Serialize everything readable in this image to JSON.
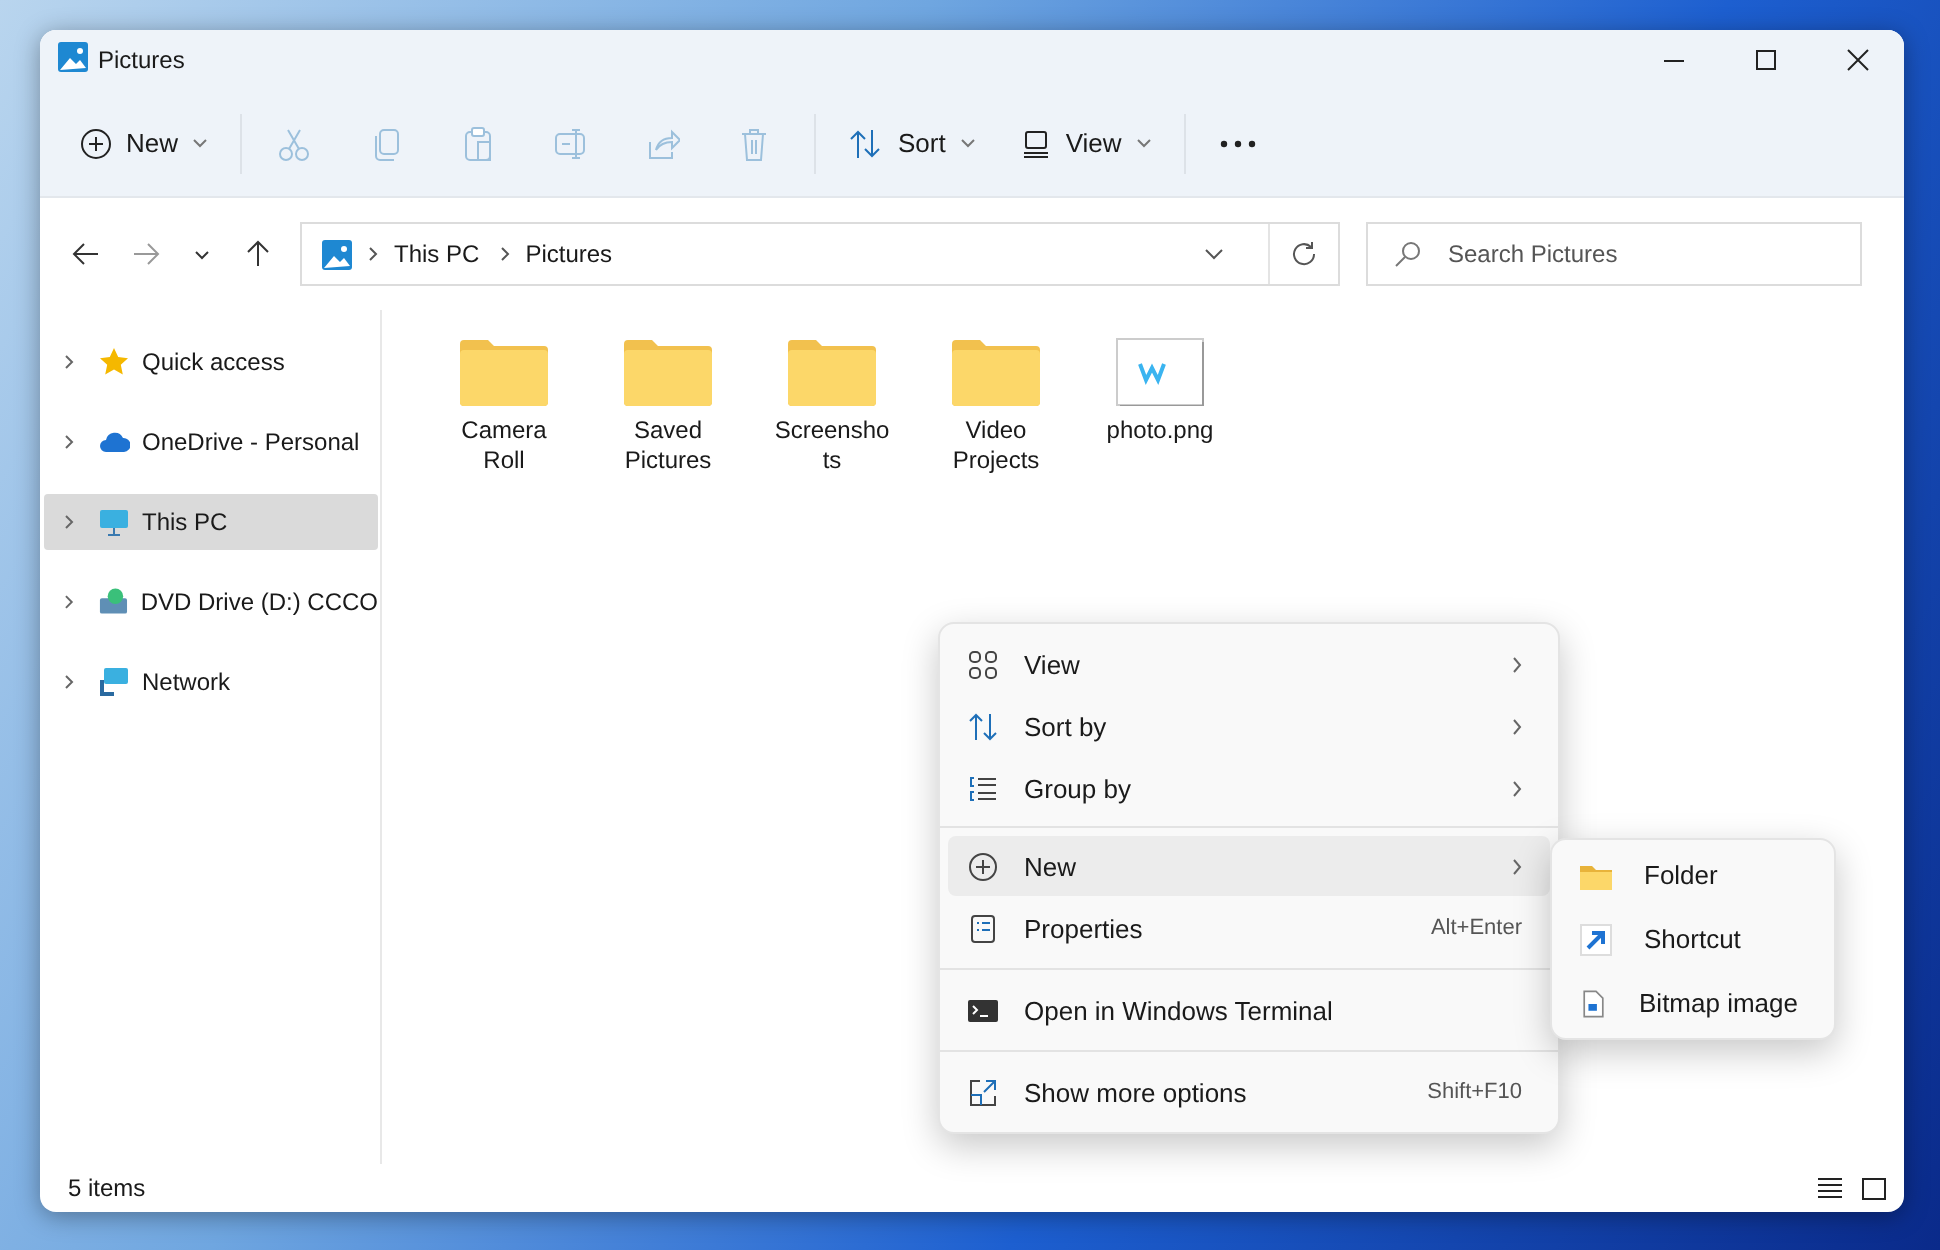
{
  "window": {
    "title": "Pictures"
  },
  "toolbar": [
    {
      "kind": "new",
      "label": "New",
      "disabled": false
    },
    {
      "kind": "cut",
      "disabled": true
    },
    {
      "kind": "copy",
      "disabled": true
    },
    {
      "kind": "paste",
      "disabled": true
    },
    {
      "kind": "rename",
      "disabled": true
    },
    {
      "kind": "share",
      "disabled": true
    },
    {
      "kind": "delete",
      "disabled": true
    },
    {
      "kind": "sort",
      "label": "Sort",
      "disabled": false
    },
    {
      "kind": "view",
      "label": "View",
      "disabled": false
    },
    {
      "kind": "more",
      "disabled": false
    }
  ],
  "navigation": {
    "back_disabled": false,
    "forward_disabled": true
  },
  "address_bar": {
    "path": [
      "This PC",
      "Pictures"
    ]
  },
  "search": {
    "placeholder": "Search Pictures"
  },
  "sidebar": {
    "items": [
      {
        "label": "Quick access",
        "selected": false
      },
      {
        "label": "OneDrive - Personal",
        "selected": false
      },
      {
        "label": "This PC",
        "selected": true
      },
      {
        "label": "DVD Drive (D:) CCCO",
        "selected": false
      },
      {
        "label": "Network",
        "selected": false
      }
    ]
  },
  "files": [
    {
      "name": "Camera Roll",
      "kind": "folder"
    },
    {
      "name": "Saved Pictures",
      "kind": "folder"
    },
    {
      "name": "Screenshots",
      "kind": "folder"
    },
    {
      "name": "Video Projects",
      "kind": "folder"
    },
    {
      "name": "photo.png",
      "kind": "image"
    }
  ],
  "context_menu": {
    "items": [
      {
        "kind": "item",
        "label": "View",
        "submenu": true,
        "selected": false
      },
      {
        "kind": "item",
        "label": "Sort by",
        "submenu": true,
        "selected": false
      },
      {
        "kind": "item",
        "label": "Group by",
        "submenu": true,
        "selected": false
      },
      {
        "kind": "separator"
      },
      {
        "kind": "item",
        "label": "New",
        "submenu": true,
        "selected": true
      },
      {
        "kind": "item",
        "label": "Properties",
        "shortcut": "Alt+Enter",
        "submenu": false,
        "selected": false
      },
      {
        "kind": "separator"
      },
      {
        "kind": "item",
        "label": "Open in Windows Terminal",
        "submenu": false,
        "selected": false
      },
      {
        "kind": "separator"
      },
      {
        "kind": "item",
        "label": "Show more options",
        "shortcut": "Shift+F10",
        "submenu": false,
        "selected": false
      }
    ]
  },
  "submenu": {
    "items": [
      {
        "label": "Folder"
      },
      {
        "label": "Shortcut"
      },
      {
        "label": "Bitmap image"
      }
    ]
  },
  "status_bar": {
    "count": "5 items"
  }
}
